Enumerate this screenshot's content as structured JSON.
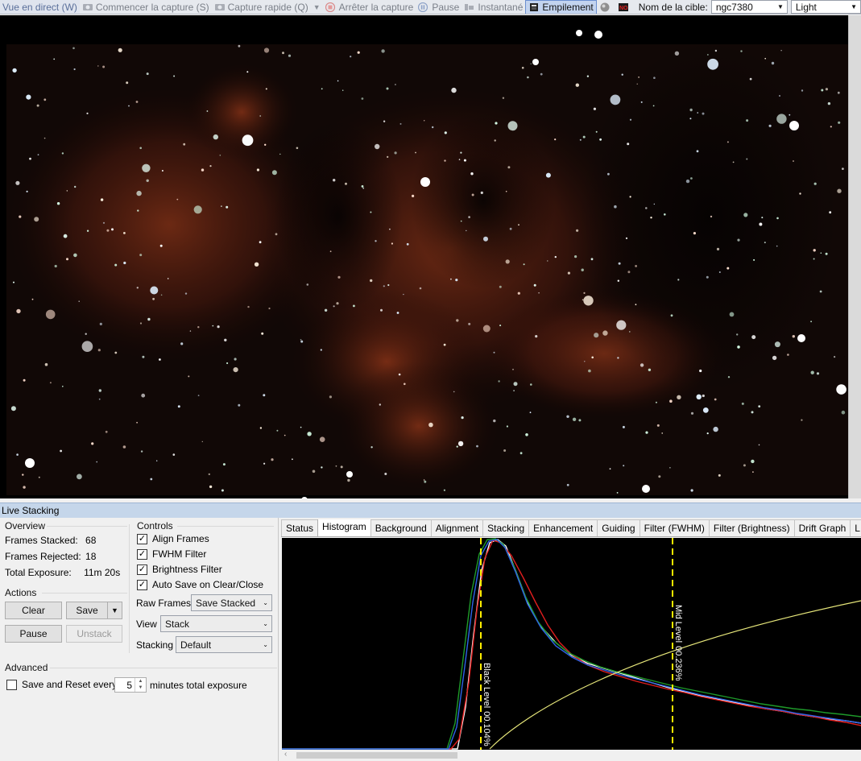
{
  "toolbar": {
    "live_view": "Vue en direct (W)",
    "start_capture": "Commencer la capture (S)",
    "quick_capture": "Capture rapide (Q)",
    "stop_capture": "Arrêter la capture",
    "pause": "Pause",
    "snapshot": "Instantané",
    "stacking": "Empilement",
    "target_label": "Nom de la cible:",
    "target_value": "ngc7380",
    "frame_type": "Light"
  },
  "panel": {
    "title": "Live Stacking",
    "overview": {
      "heading": "Overview",
      "frames_stacked_label": "Frames Stacked:",
      "frames_stacked_value": "68",
      "frames_rejected_label": "Frames Rejected:",
      "frames_rejected_value": "18",
      "total_exposure_label": "Total Exposure:",
      "total_exposure_value": "11m 20s"
    },
    "actions": {
      "heading": "Actions",
      "clear": "Clear",
      "save": "Save",
      "pause": "Pause",
      "unstack": "Unstack"
    },
    "controls": {
      "heading": "Controls",
      "align_frames": "Align Frames",
      "fwhm_filter": "FWHM Filter",
      "brightness_filter": "Brightness Filter",
      "auto_save": "Auto Save on Clear/Close",
      "raw_frames_label": "Raw Frames",
      "raw_frames_value": "Save Stacked",
      "view_label": "View",
      "view_value": "Stack",
      "stacking_label": "Stacking",
      "stacking_value": "Default"
    },
    "advanced": {
      "heading": "Advanced",
      "save_reset_label": "Save and Reset every",
      "minutes_value": "5",
      "minutes_suffix": "minutes total exposure"
    },
    "tabs": [
      "Status",
      "Histogram",
      "Background",
      "Alignment",
      "Stacking",
      "Enhancement",
      "Guiding",
      "Filter (FWHM)",
      "Filter (Brightness)",
      "Drift Graph",
      "L"
    ],
    "histogram": {
      "black_level_label": "Black Level",
      "black_level_value": "00.104%",
      "mid_level_label": "Mid Level",
      "mid_level_value": "00.236%"
    }
  },
  "colors": {
    "accent": "#3c7fd0",
    "panel_title_bg": "#c5d6ea",
    "marker_yellow": "#ffee00"
  },
  "icons": [
    "camera-icon",
    "quick-camera-icon",
    "stop-icon",
    "pause-icon",
    "snapshot-icon",
    "stack-icon",
    "sphere-icon",
    "no-entry-icon",
    "chevron-down-icon",
    "checkmark-icon"
  ]
}
